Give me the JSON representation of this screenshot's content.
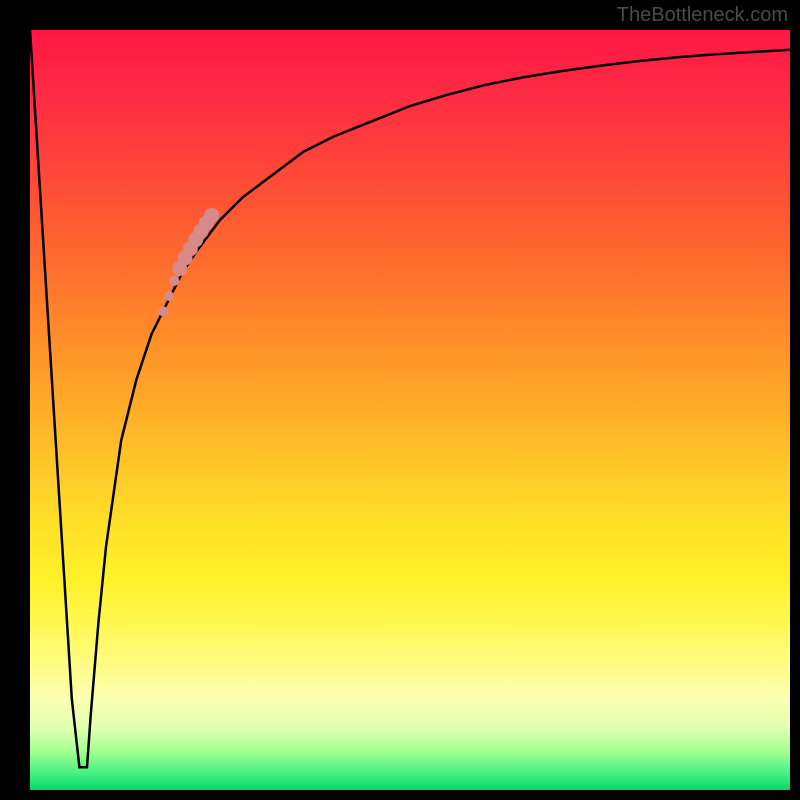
{
  "watermark": "TheBottleneck.com",
  "colors": {
    "frame": "#000000",
    "curve": "#000000",
    "dots": "#d88a8a",
    "gradient_top": "#ff1744",
    "gradient_bottom": "#00d968"
  },
  "chart_data": {
    "type": "line",
    "title": "",
    "xlabel": "",
    "ylabel": "",
    "xlim": [
      0,
      100
    ],
    "ylim": [
      0,
      100
    ],
    "grid": false,
    "series": [
      {
        "name": "bottleneck-curve",
        "x": [
          0,
          2,
          4,
          5.5,
          6.5,
          7.5,
          8,
          9,
          10,
          12,
          14,
          16,
          18,
          20,
          22,
          25,
          28,
          32,
          36,
          40,
          45,
          50,
          55,
          60,
          65,
          70,
          75,
          80,
          85,
          90,
          95,
          100
        ],
        "y": [
          100,
          68,
          36,
          12,
          3,
          3,
          10,
          22,
          32,
          46,
          54,
          60,
          64,
          68,
          71,
          75,
          78,
          81,
          84,
          86,
          88,
          90,
          91.5,
          92.8,
          93.8,
          94.6,
          95.3,
          95.9,
          96.4,
          96.8,
          97.1,
          97.4
        ]
      }
    ],
    "markers": [
      {
        "x": 17.5,
        "y": 63,
        "r": 5
      },
      {
        "x": 18.3,
        "y": 65,
        "r": 5
      },
      {
        "x": 19.0,
        "y": 67,
        "r": 5
      },
      {
        "x": 19.7,
        "y": 68.6,
        "r": 7.5
      },
      {
        "x": 20.4,
        "y": 70,
        "r": 7.5
      },
      {
        "x": 21.1,
        "y": 71.2,
        "r": 7.5
      },
      {
        "x": 21.8,
        "y": 72.4,
        "r": 7.5
      },
      {
        "x": 22.5,
        "y": 73.5,
        "r": 7.5
      },
      {
        "x": 23.2,
        "y": 74.6,
        "r": 7.5
      },
      {
        "x": 23.9,
        "y": 75.6,
        "r": 7.5
      }
    ]
  }
}
